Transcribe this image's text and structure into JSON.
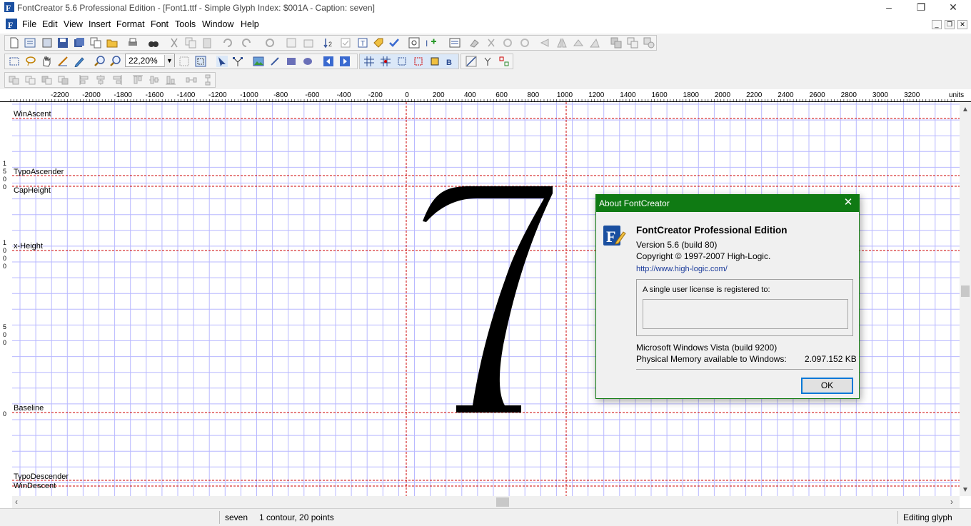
{
  "window": {
    "title": "FontCreator 5.6 Professional Edition - [Font1.ttf - Simple Glyph Index: $001A - Caption: seven]",
    "minimize": "–",
    "maximize": "❐",
    "close": "✕"
  },
  "menu": {
    "items": [
      "File",
      "Edit",
      "View",
      "Insert",
      "Format",
      "Font",
      "Tools",
      "Window",
      "Help"
    ],
    "mdi_minimize": "_",
    "mdi_restore": "❐",
    "mdi_close": "✕"
  },
  "toolbar": {
    "zoom_value": "22,20%"
  },
  "ruler": {
    "labels": [
      "-2200",
      "-2000",
      "-1800",
      "-1600",
      "-1400",
      "-1200",
      "-1000",
      "-800",
      "-600",
      "-400",
      "-200",
      "0",
      "200",
      "400",
      "600",
      "800",
      "1000",
      "1200",
      "1400",
      "1600",
      "1800",
      "2000",
      "2200",
      "2400",
      "2600",
      "2800",
      "3000",
      "3200"
    ],
    "units": "units"
  },
  "metrics": {
    "win_ascent": "WinAscent",
    "typo_ascender": "TypoAscender",
    "cap_height": "CapHeight",
    "x_height": "x-Height",
    "baseline": "Baseline",
    "typo_descender": "TypoDescender",
    "win_descent": "WinDescent"
  },
  "glyph": {
    "character": "7"
  },
  "dialog": {
    "title": "About FontCreator",
    "product": "FontCreator Professional Edition",
    "version": "Version 5.6 (build 80)",
    "copyright": "Copyright © 1997-2007 High-Logic.",
    "url": "http://www.high-logic.com/",
    "license_label": "A single user license is registered to:",
    "license_value": "",
    "os": "Microsoft Windows Vista (build 9200)",
    "memory_label": "Physical Memory available to Windows:",
    "memory_value": "2.097.152 KB",
    "ok": "OK"
  },
  "status": {
    "glyph_name": "seven",
    "contours": "1 contour, 20 points",
    "mode": "Editing glyph"
  },
  "colors": {
    "dialog_title_bg": "#0f7a13",
    "grid_line": "#b8b8ff",
    "metric_line": "#cc0000"
  }
}
